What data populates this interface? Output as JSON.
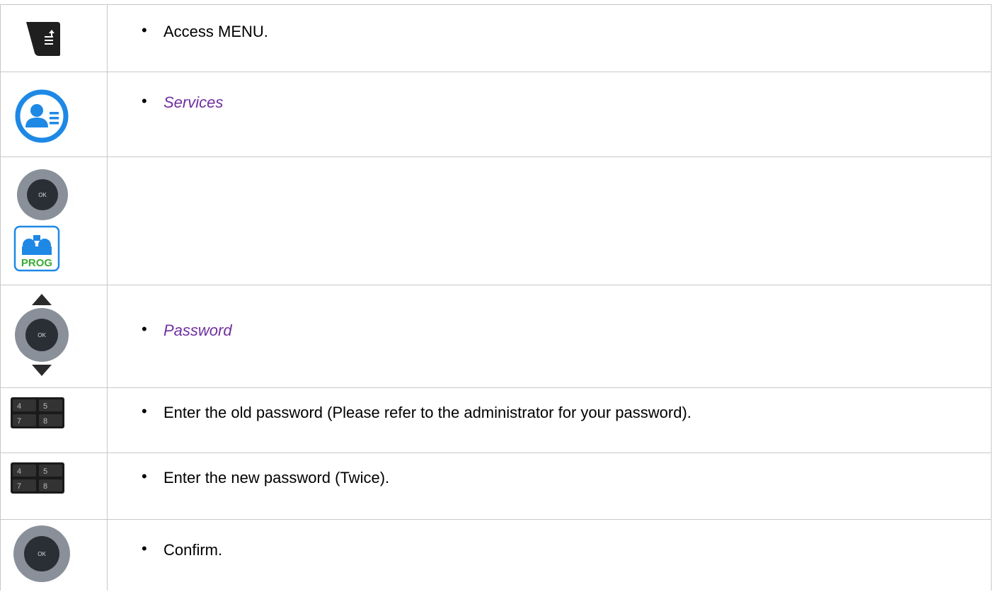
{
  "steps": [
    {
      "icon": "menu-key-icon",
      "text": "Access MENU.",
      "style": "normal"
    },
    {
      "icon": "services-icon",
      "text": "Services",
      "style": "italic-accent"
    },
    {
      "icon": "navigator-left-right-and-prog-icon",
      "text": "",
      "style": "normal"
    },
    {
      "icon": "navigator-up-down-icon",
      "text": "Password",
      "style": "italic-accent"
    },
    {
      "icon": "keypad-icon",
      "text": "Enter the old password (Please refer to the administrator for your password).",
      "style": "normal"
    },
    {
      "icon": "keypad-icon",
      "text": "Enter the new password (Twice).",
      "style": "normal"
    },
    {
      "icon": "ok-key-icon",
      "text": "Confirm.",
      "style": "normal"
    }
  ],
  "colors": {
    "accent_text": "#7030a0",
    "services_blue": "#1e88e5",
    "prog_green": "#3aaa35",
    "border": "#c8c8c8"
  }
}
